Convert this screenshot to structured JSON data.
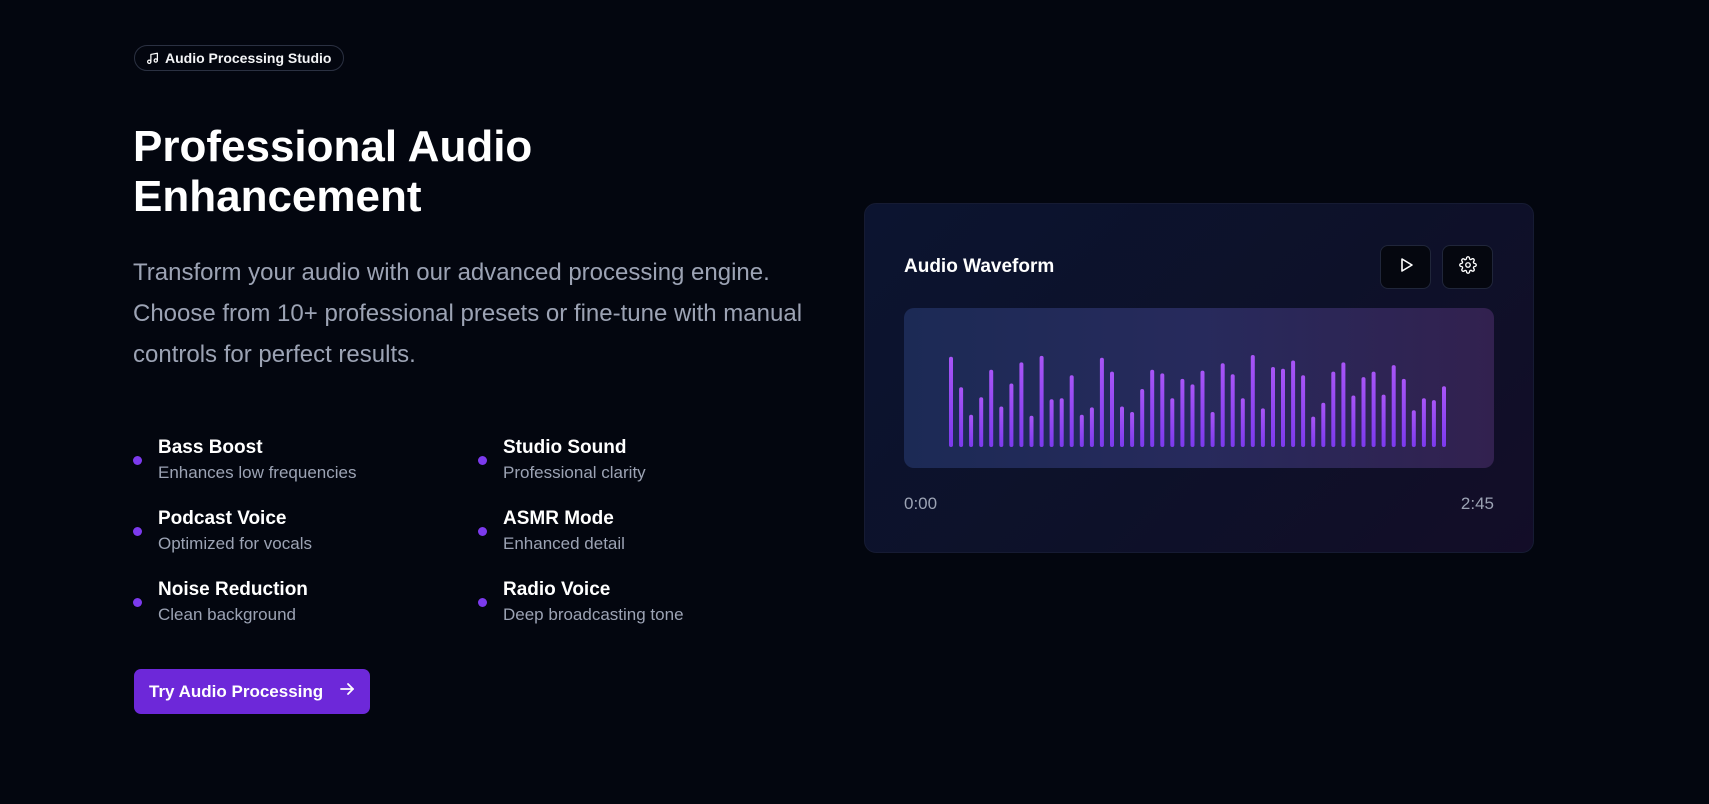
{
  "badge": {
    "icon": "music-note-icon",
    "label": "Audio Processing Studio"
  },
  "hero": {
    "title_line1": "Professional Audio",
    "title_line2": "Enhancement",
    "description": "Transform your audio with our advanced processing engine. Choose from 10+ professional presets or fine-tune with manual controls for perfect results."
  },
  "features": [
    {
      "title": "Bass Boost",
      "subtitle": "Enhances low frequencies"
    },
    {
      "title": "Studio Sound",
      "subtitle": "Professional clarity"
    },
    {
      "title": "Podcast Voice",
      "subtitle": "Optimized for vocals"
    },
    {
      "title": "ASMR Mode",
      "subtitle": "Enhanced detail"
    },
    {
      "title": "Noise Reduction",
      "subtitle": "Clean background"
    },
    {
      "title": "Radio Voice",
      "subtitle": "Deep broadcasting tone"
    }
  ],
  "cta": {
    "label": "Try Audio Processing",
    "icon": "arrow-right-icon"
  },
  "player": {
    "title": "Audio Waveform",
    "play_icon": "play-icon",
    "settings_icon": "gear-icon",
    "time_start": "0:00",
    "time_end": "2:45",
    "waveform_levels": [
      0.98,
      0.65,
      0.35,
      0.54,
      0.84,
      0.44,
      0.69,
      0.92,
      0.34,
      0.99,
      0.52,
      0.53,
      0.78,
      0.35,
      0.43,
      0.97,
      0.82,
      0.44,
      0.38,
      0.63,
      0.84,
      0.8,
      0.53,
      0.74,
      0.68,
      0.83,
      0.38,
      0.91,
      0.79,
      0.53,
      1.0,
      0.42,
      0.87,
      0.85,
      0.94,
      0.78,
      0.33,
      0.48,
      0.82,
      0.92,
      0.56,
      0.76,
      0.82,
      0.57,
      0.89,
      0.74,
      0.4,
      0.53,
      0.51,
      0.66
    ],
    "colors": {
      "bar_top": "#a855f7",
      "bar_bottom": "#7c3aed",
      "accent": "#6d28d9"
    }
  }
}
